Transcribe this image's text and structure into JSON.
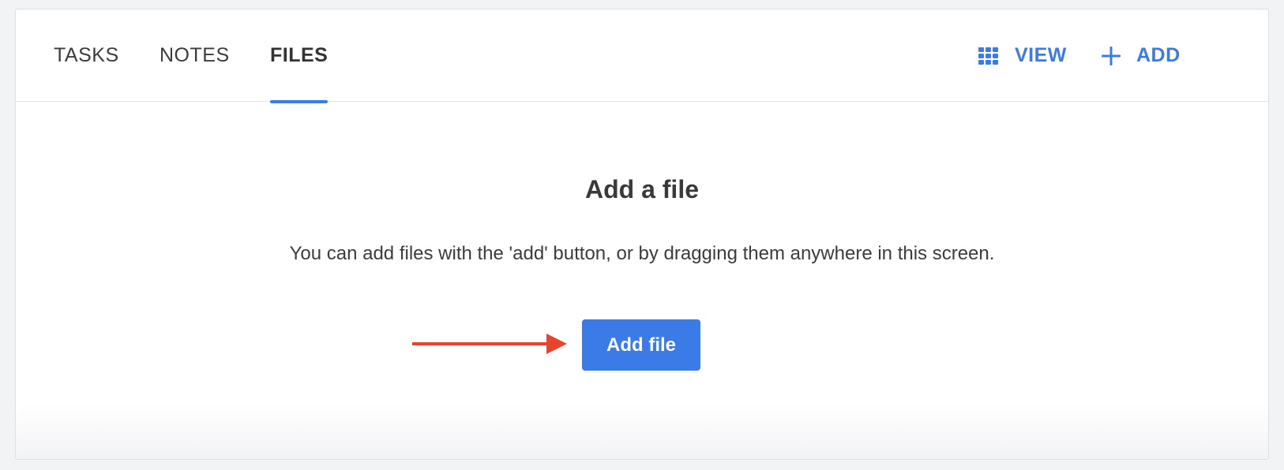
{
  "tabs": [
    {
      "label": "TASKS",
      "active": false
    },
    {
      "label": "NOTES",
      "active": false
    },
    {
      "label": "FILES",
      "active": true
    }
  ],
  "actions": {
    "view_label": "VIEW",
    "view_icon": "grid-icon",
    "add_label": "ADD",
    "add_icon": "plus-icon"
  },
  "empty_state": {
    "title": "Add a file",
    "description": "You can add files with the 'add' button, or by dragging them anywhere in this screen.",
    "button_label": "Add file"
  },
  "annotation": {
    "icon": "arrow-right-icon",
    "color": "#e8432d"
  },
  "colors": {
    "accent": "#3b7be8",
    "background": "#f2f3f5",
    "card": "#ffffff"
  }
}
